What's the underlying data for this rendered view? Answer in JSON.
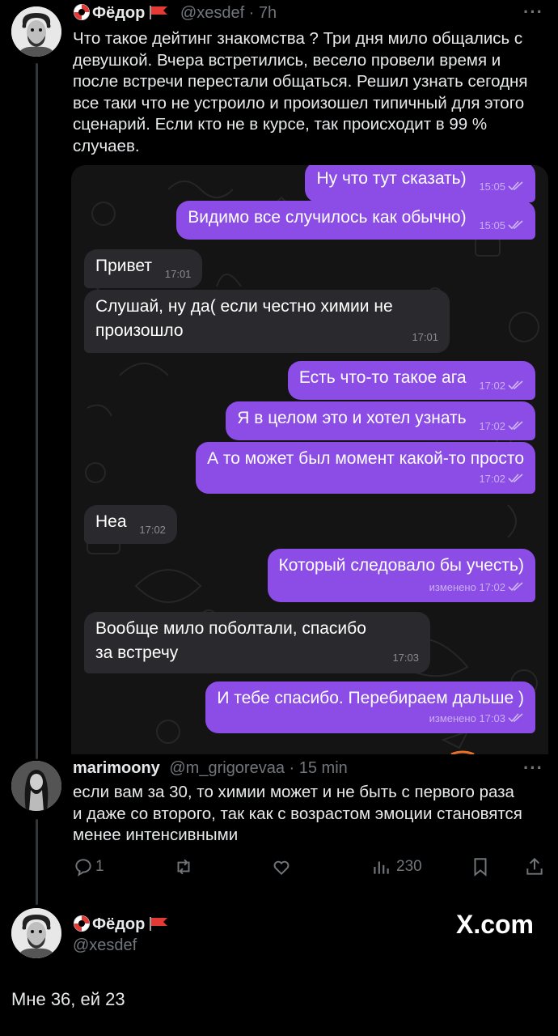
{
  "tweet": {
    "author_name": "Фёдор",
    "author_handle": "@xesdef",
    "time": "7h",
    "text": "Что такое дейтинг знакомства ? Три дня мило общались с девушкой. Вчера встретились, весело провели время и после встречи перестали общаться. Решил узнать сегодня все таки что не устроило и произошел типичный для этого сценарий. Если кто не в курсе, так происходит в 99 % случаев.",
    "more_icon": "more-dots-icon"
  },
  "chat": {
    "messages": [
      {
        "dir": "out",
        "text": "Ну что тут сказать)",
        "time": "15:05",
        "edited": ""
      },
      {
        "dir": "out",
        "text": "Видимо все случилось как обычно)",
        "time": "15:05",
        "edited": ""
      },
      {
        "dir": "in",
        "text": "Привет",
        "time": "17:01",
        "edited": ""
      },
      {
        "dir": "in",
        "text": "Слушай, ну да( если честно химии не произошло",
        "time": "17:01",
        "edited": ""
      },
      {
        "dir": "out",
        "text": "Есть что-то такое ага",
        "time": "17:02",
        "edited": ""
      },
      {
        "dir": "out",
        "text": "Я в целом это и хотел узнать",
        "time": "17:02",
        "edited": ""
      },
      {
        "dir": "out",
        "text": "А то может был момент какой-то просто",
        "time": "17:02",
        "edited": ""
      },
      {
        "dir": "in",
        "text": "Неа",
        "time": "17:02",
        "edited": ""
      },
      {
        "dir": "out",
        "text": "Который следовало бы учесть)",
        "time": "17:02",
        "edited": "изменено"
      },
      {
        "dir": "in",
        "text": "Вообще мило поболтали, спасибо за встречу",
        "time": "17:03",
        "edited": ""
      },
      {
        "dir": "out",
        "text": "И тебе спасибо. Перебираем дальше )",
        "time": "17:03",
        "edited": "изменено"
      }
    ]
  },
  "reply": {
    "author_name": "marimoony",
    "author_handle": "@m_grigorevaa",
    "time": "15 min",
    "text": "если вам за 30, то химии может и не быть с первого раза и даже со второго, так как с возрастом эмоции становятся менее интенсивными",
    "actions": {
      "replies": "1",
      "reposts": "",
      "likes": "",
      "views": "230"
    }
  },
  "footer": {
    "author_name": "Фёдор",
    "author_handle": "@xesdef",
    "brand": "X.com",
    "text": "Мне 36, ей 23"
  },
  "colors": {
    "background": "#000000",
    "outgoing_bubble": "#8b4de6",
    "incoming_bubble": "#2a2a2e",
    "muted": "#71767b"
  }
}
